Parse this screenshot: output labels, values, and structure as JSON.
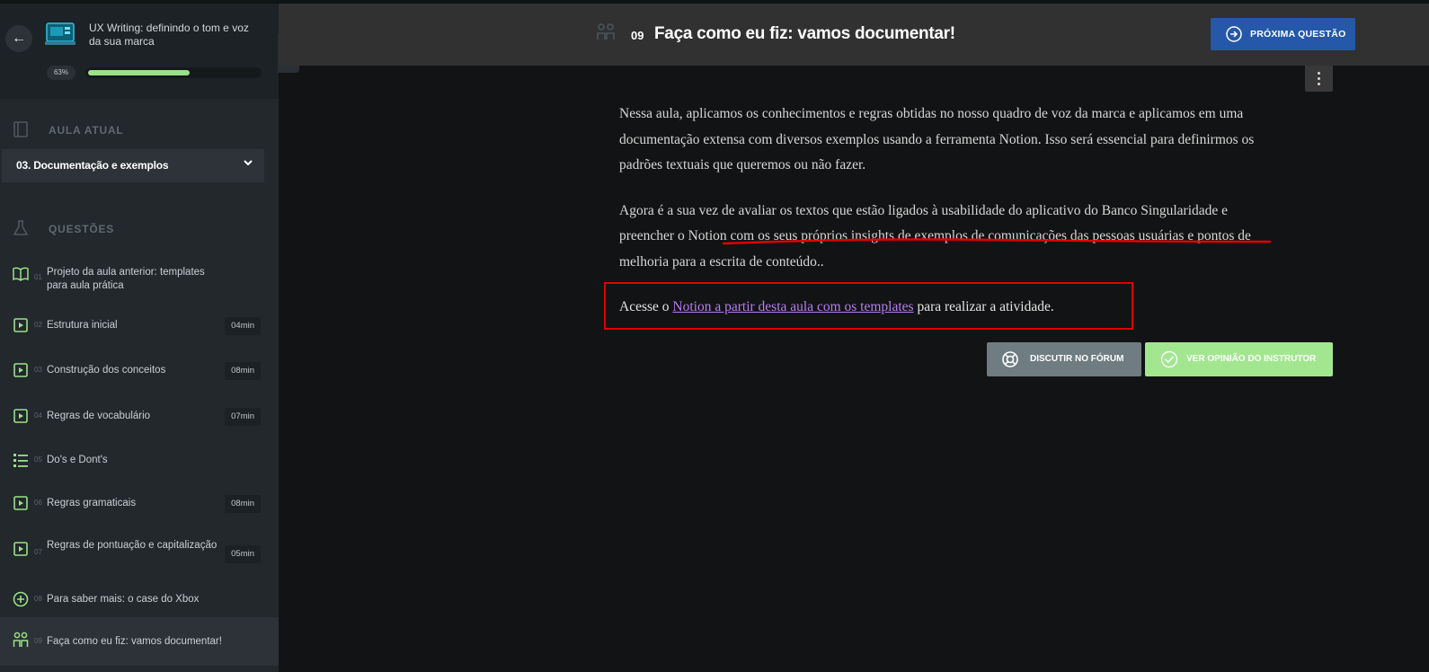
{
  "course": {
    "title": "UX Writing: definindo o tom e voz da sua marca",
    "progress_label": "63%",
    "progress": 0.63
  },
  "sidebar": {
    "current_lesson_label": "AULA ATUAL",
    "current_lesson": "03. Documentação e exemplos",
    "questions_label": "QUESTÕES",
    "tasks": [
      {
        "num": "01",
        "title": "Projeto da aula anterior: templates para aula prática",
        "duration": "",
        "icon": "book-open-icon"
      },
      {
        "num": "02",
        "title": "Estrutura inicial",
        "duration": "04min",
        "icon": "video-play-icon"
      },
      {
        "num": "03",
        "title": "Construção dos conceitos",
        "duration": "08min",
        "icon": "video-play-icon"
      },
      {
        "num": "04",
        "title": "Regras de vocabulário",
        "duration": "07min",
        "icon": "video-play-icon"
      },
      {
        "num": "05",
        "title": "Do's e Dont's",
        "duration": "",
        "icon": "list-icon"
      },
      {
        "num": "06",
        "title": "Regras gramaticais",
        "duration": "08min",
        "icon": "video-play-icon"
      },
      {
        "num": "07",
        "title": "Regras de pontuação e capitalização",
        "duration": "05min",
        "icon": "video-play-icon"
      },
      {
        "num": "08",
        "title": "Para saber mais: o case do Xbox",
        "duration": "",
        "icon": "plus-circle-icon"
      },
      {
        "num": "09",
        "title": "Faça como eu fiz: vamos documentar!",
        "duration": "",
        "icon": "people-icon"
      }
    ]
  },
  "header": {
    "num": "09",
    "title": "Faça como eu fiz: vamos documentar!",
    "next_label": "PRÓXIMA QUESTÃO"
  },
  "content": {
    "p1": "Nessa aula, aplicamos os conhecimentos e regras obtidas no nosso quadro de voz da marca e aplicamos em uma documentação extensa com diversos exemplos usando a ferramenta Notion. Isso será essencial para definirmos os padrões textuais que queremos ou não fazer.",
    "p2": "Agora é a sua vez de avaliar os textos que estão ligados à usabilidade do aplicativo do Banco Singularidade e preencher o Notion com os seus próprios insights de exemplos de comunicações das pessoas usuárias e pontos de melhoria para a escrita de conteúdo..",
    "access_prefix": "Acesse o ",
    "access_link": "Notion a partir desta aula com os templates",
    "access_suffix": " para realizar a atividade."
  },
  "actions": {
    "forum_label": "DISCUTIR NO FÓRUM",
    "instructor_label": "VER OPINIÃO DO INSTRUTOR"
  },
  "colors": {
    "accent_green": "#9be186",
    "next_button": "#2558a8",
    "link": "#b77df2",
    "highlight_red": "#e00000"
  }
}
